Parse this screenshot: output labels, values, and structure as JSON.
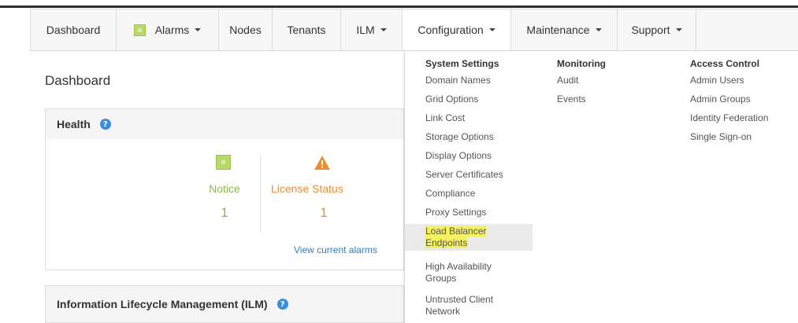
{
  "nav": {
    "items": [
      {
        "label": "Dashboard"
      },
      {
        "label": "Alarms"
      },
      {
        "label": "Nodes"
      },
      {
        "label": "Tenants"
      },
      {
        "label": "ILM"
      },
      {
        "label": "Configuration"
      },
      {
        "label": "Maintenance"
      },
      {
        "label": "Support"
      }
    ]
  },
  "page": {
    "title": "Dashboard"
  },
  "health": {
    "title": "Health",
    "notice_label": "Notice",
    "notice_count": "1",
    "license_label": "License Status",
    "license_count": "1",
    "view_alarms": "View current alarms",
    "colors": {
      "notice": "#8bb94a",
      "license": "#ec8d2f"
    }
  },
  "ilm": {
    "title": "Information Lifecycle Management (ILM)"
  },
  "config_menu": {
    "system_settings": {
      "heading": "System Settings",
      "items": [
        "Domain Names",
        "Grid Options",
        "Link Cost",
        "Storage Options",
        "Display Options",
        "Server Certificates",
        "Compliance",
        "Proxy Settings",
        "Load Balancer",
        "Endpoints",
        "High Availability",
        "Groups",
        "Untrusted Client",
        "Network"
      ]
    },
    "monitoring": {
      "heading": "Monitoring",
      "items": [
        "Audit",
        "Events"
      ]
    },
    "access_control": {
      "heading": "Access Control",
      "items": [
        "Admin Users",
        "Admin Groups",
        "Identity Federation",
        "Single Sign-on"
      ]
    }
  },
  "icons": [
    "alarm-square-icon",
    "info-icon",
    "notice-square-icon",
    "warning-triangle-icon",
    "caret-down-icon"
  ]
}
